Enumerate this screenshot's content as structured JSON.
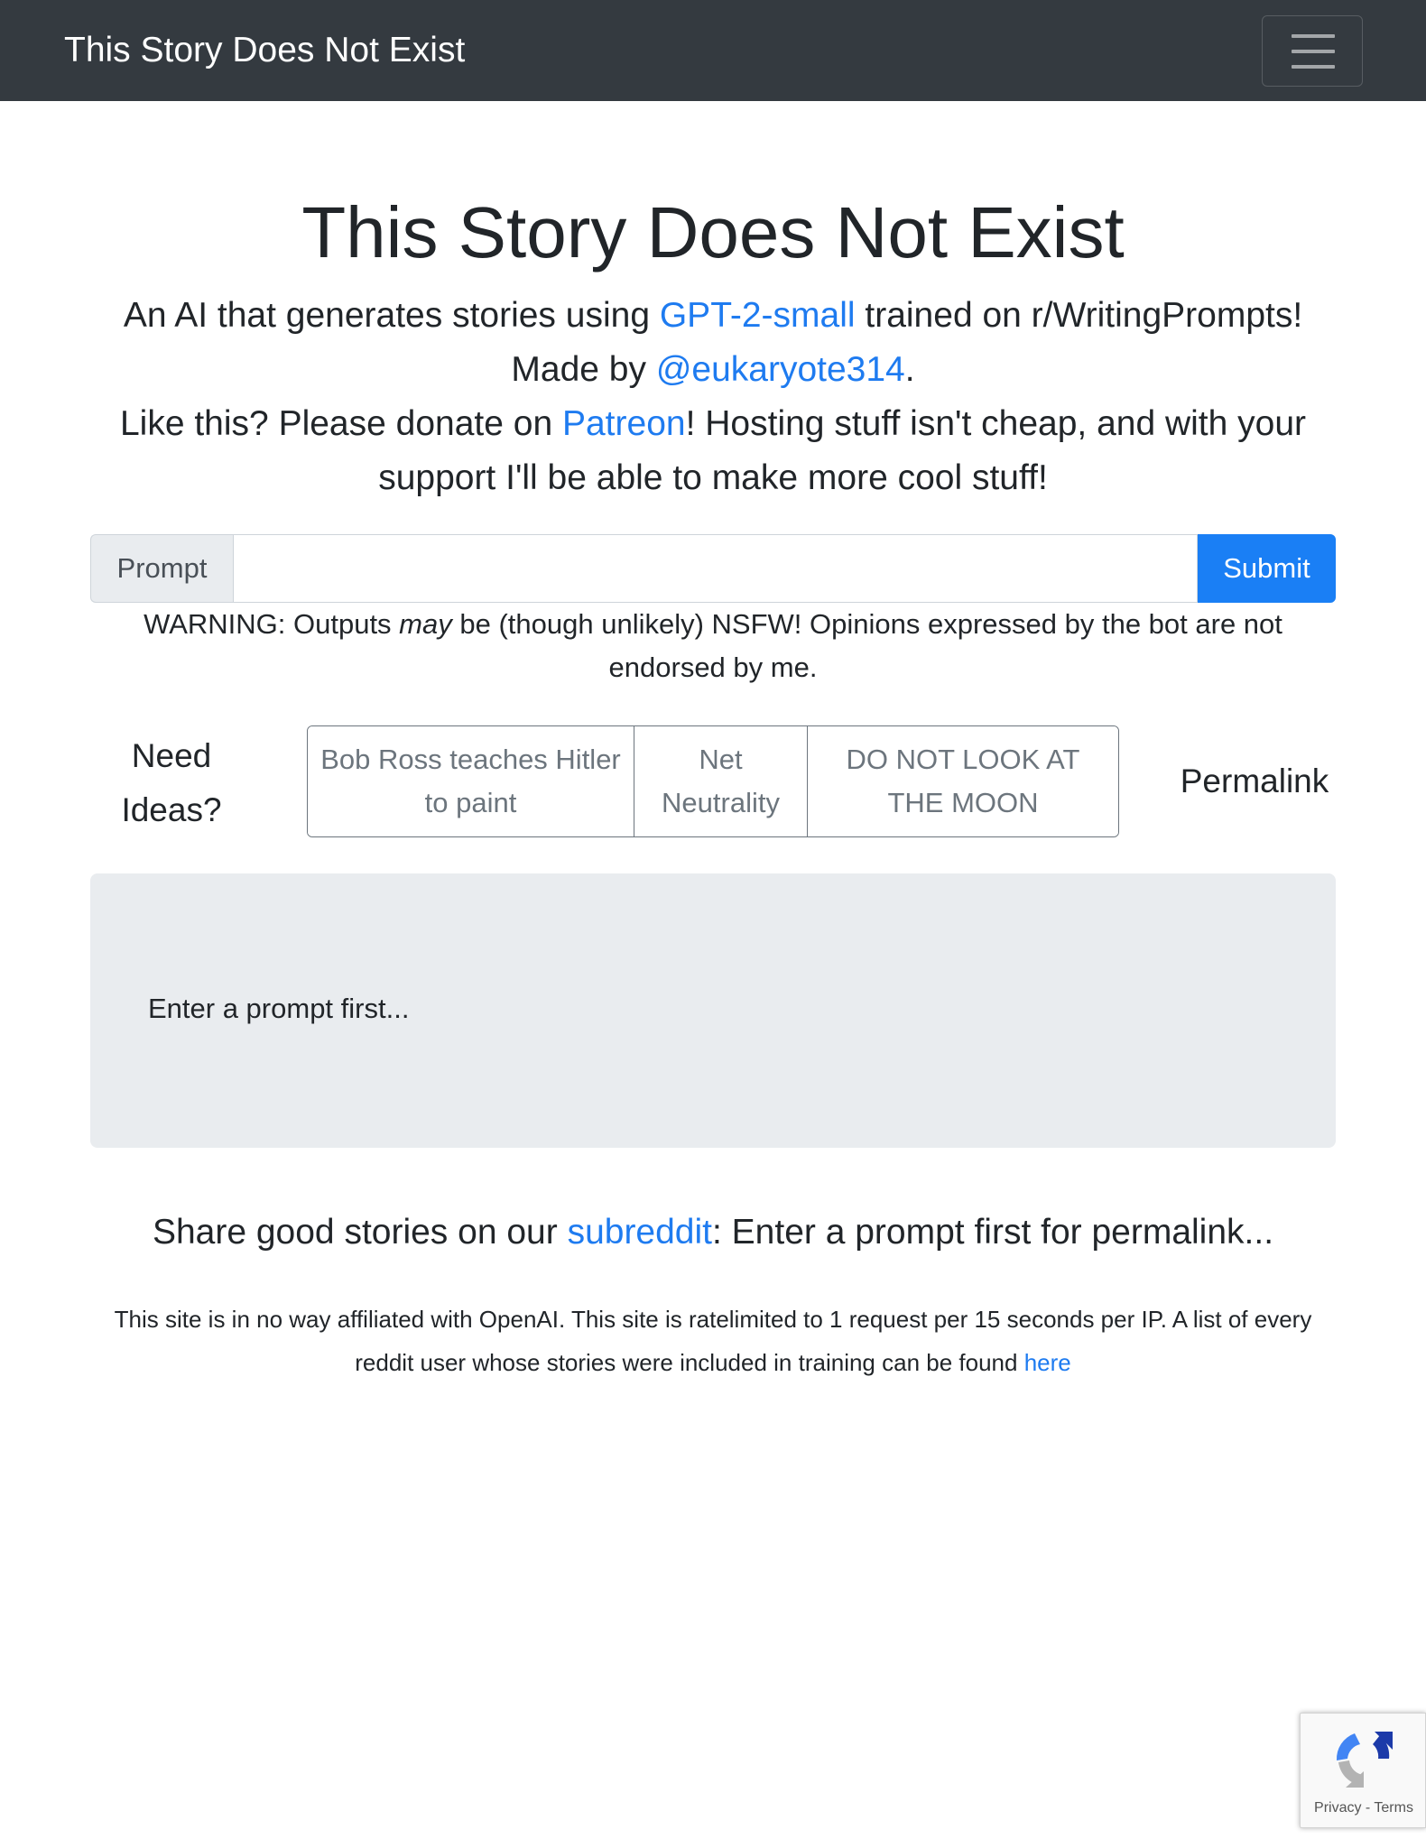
{
  "navbar": {
    "brand": "This Story Does Not Exist",
    "toggler_icon": "hamburger-menu-icon"
  },
  "hero": {
    "title": "This Story Does Not Exist",
    "line1_pre": "An AI that generates stories using ",
    "line1_link": "GPT-2-small",
    "line1_post": " trained on r/WritingPrompts!",
    "line2_pre": "Made by ",
    "line2_link": "@eukaryote314",
    "line2_post": ".",
    "line3_pre": "Like this? Please donate on ",
    "line3_link": "Patreon",
    "line3_post": "! Hosting stuff isn't cheap, and with your support I'll be able to make more cool stuff!"
  },
  "prompt": {
    "addon_label": "Prompt",
    "input_value": "",
    "submit_label": "Submit"
  },
  "warning": {
    "pre": "WARNING: Outputs ",
    "emphasis": "may",
    "post": " be (though unlikely) NSFW! Opinions expressed by the bot are not endorsed by me."
  },
  "ideas": {
    "label": "Need Ideas?",
    "buttons": [
      {
        "label": "Bob Ross teaches Hitler to paint"
      },
      {
        "label": "Net Neutrality"
      },
      {
        "label": "DO NOT LOOK AT THE MOON"
      }
    ],
    "permalink_label": "Permalink"
  },
  "output": {
    "text": "Enter a prompt first..."
  },
  "share": {
    "pre": "Share good stories on our ",
    "link": "subreddit",
    "post": ": Enter a prompt first for permalink..."
  },
  "footer": {
    "text": "This site is in no way affiliated with OpenAI. This site is ratelimited to 1 request per 15 seconds per IP. A list of every reddit user whose stories were included in training can be found ",
    "link": "here"
  },
  "recaptcha": {
    "icon": "recaptcha-logo-icon",
    "privacy": "Privacy",
    "separator": " - ",
    "terms": "Terms"
  },
  "colors": {
    "navbar_bg": "#343a40",
    "link": "#1e7bf0",
    "primary_button": "#1a7ff5",
    "output_bg": "#e9ecef"
  }
}
